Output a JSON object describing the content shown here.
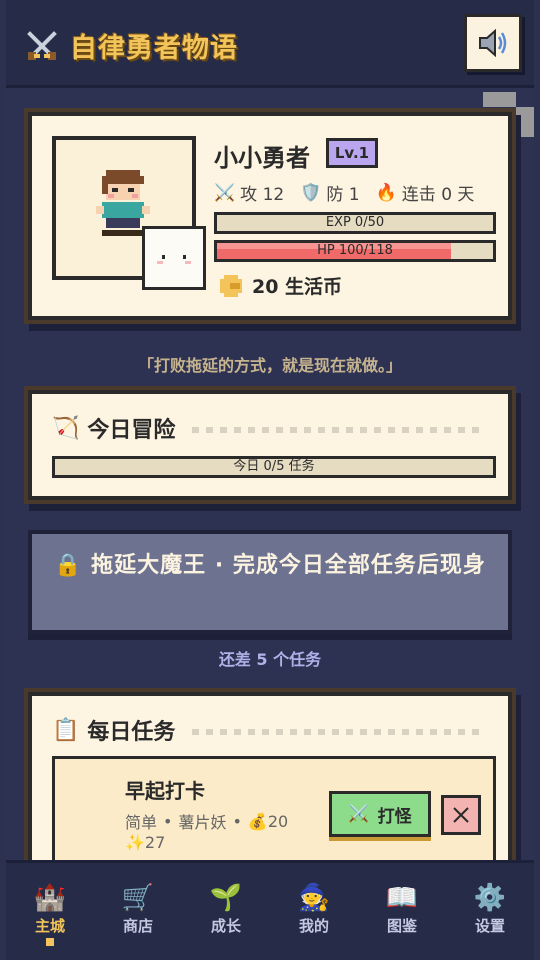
{
  "header": {
    "title": "自律勇者物语",
    "title_icon": "crossed-swords-icon",
    "sound_icon": "speaker-icon"
  },
  "profile": {
    "name": "小小勇者",
    "level": "Lv.1",
    "attack_label": "攻 12",
    "defense_label": "防 1",
    "streak_label": "连击 0 天",
    "exp_text": "EXP 0/50",
    "exp_progress": 0,
    "hp_text": "HP 100/118",
    "hp_progress": 0.847,
    "coins_text": "20 生活币"
  },
  "motto": "「打败拖延的方式，就是现在就做。」",
  "adventure": {
    "title": "今日冒险",
    "progress_text": "今日 0/5 任务",
    "progress": 0
  },
  "boss": {
    "text": "🔒 拖延大魔王 · 完成今日全部任务后现身"
  },
  "remaining_text": "还差 5 个任务",
  "daily_tasks": {
    "title": "每日任务",
    "items": [
      {
        "name": "早起打卡",
        "difficulty": "简单",
        "monster": "薯片妖",
        "coins": "💰20",
        "xp": "✨27",
        "fight_label": "打怪"
      }
    ]
  },
  "nav": {
    "items": [
      {
        "label": "主城",
        "icon": "🏰"
      },
      {
        "label": "商店",
        "icon": "🛒"
      },
      {
        "label": "成长",
        "icon": "🌱"
      },
      {
        "label": "我的",
        "icon": "🧙"
      },
      {
        "label": "图鉴",
        "icon": "📖"
      },
      {
        "label": "设置",
        "icon": "⚙️"
      }
    ],
    "active": "主城"
  },
  "colors": {
    "background": "#2d3252",
    "panel": "#fdf4e1",
    "accent_gold": "#f2c45a",
    "level_badge": "#b9a6ee",
    "hp_fill": "#ef6a68",
    "fight_button": "#8ddc8b",
    "close_button": "#f3b3b0",
    "boss_panel": "#6c7290"
  }
}
